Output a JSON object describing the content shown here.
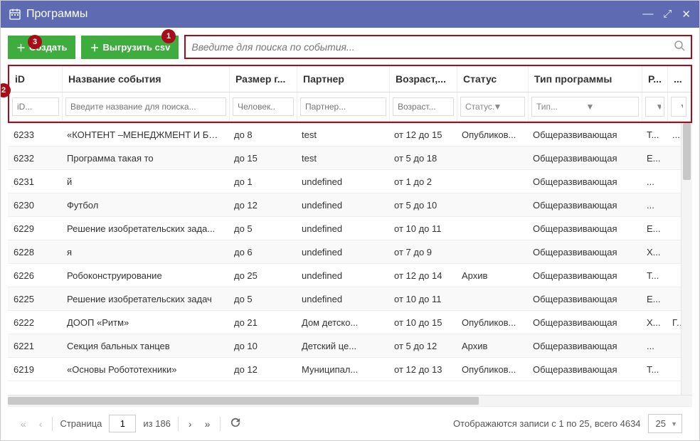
{
  "window": {
    "title": "Программы"
  },
  "toolbar": {
    "create_label": "Создать",
    "export_label": "Выгрузить csv",
    "search_placeholder": "Введите для поиска по события..."
  },
  "markers": {
    "m1": "1",
    "m2": "2",
    "m3": "3"
  },
  "columns": {
    "id": "iD",
    "name": "Название события",
    "size": "Размер г...",
    "partner": "Партнер",
    "age": "Возраст,...",
    "status": "Статус",
    "type": "Тип программы",
    "r": "Р...",
    "dots": "..."
  },
  "filters": {
    "id": "iD...",
    "name": "Введите название для поиска...",
    "size": "Человек..",
    "partner": "Партнер...",
    "age": "Возраст...",
    "status": "Статус...",
    "type": "Тип..."
  },
  "rows": [
    {
      "id": "6233",
      "name": "«КОНТЕНТ –МЕНЕДЖМЕНТ И БЛО...",
      "size": "до 8",
      "partner": "test",
      "age": "от 12 до 15",
      "status": "Опубликов...",
      "type": "Общеразвивающая",
      "r": "Т...",
      "dots": "..."
    },
    {
      "id": "6232",
      "name": "Программа такая то",
      "size": "до 15",
      "partner": "test",
      "age": "от 5 до 18",
      "status": "",
      "type": "Общеразвивающая",
      "r": "Е...",
      "dots": ""
    },
    {
      "id": "6231",
      "name": "й",
      "size": "до 1",
      "partner": "undefined",
      "age": "от 1 до 2",
      "status": "",
      "type": "Общеразвивающая",
      "r": "...",
      "dots": ""
    },
    {
      "id": "6230",
      "name": "Футбол",
      "size": "до 12",
      "partner": "undefined",
      "age": "от 5 до 10",
      "status": "",
      "type": "Общеразвивающая",
      "r": "...",
      "dots": ""
    },
    {
      "id": "6229",
      "name": "Решение изобретательских зада...",
      "size": "до 5",
      "partner": "undefined",
      "age": "от 10 до 11",
      "status": "",
      "type": "Общеразвивающая",
      "r": "Е...",
      "dots": ""
    },
    {
      "id": "6228",
      "name": "я",
      "size": "до 6",
      "partner": "undefined",
      "age": "от 7 до 9",
      "status": "",
      "type": "Общеразвивающая",
      "r": "Х...",
      "dots": ""
    },
    {
      "id": "6226",
      "name": "Робоконструирование",
      "size": "до 25",
      "partner": "undefined",
      "age": "от 12 до 14",
      "status": "Архив",
      "type": "Общеразвивающая",
      "r": "Т...",
      "dots": ""
    },
    {
      "id": "6225",
      "name": "Решение изобретательских задач",
      "size": "до 5",
      "partner": "undefined",
      "age": "от 10 до 11",
      "status": "",
      "type": "Общеразвивающая",
      "r": "Е...",
      "dots": ""
    },
    {
      "id": "6222",
      "name": "ДООП «Ритм»",
      "size": "до 21",
      "partner": "Дом детско...",
      "age": "от 10 до 15",
      "status": "Опубликов...",
      "type": "Общеразвивающая",
      "r": "Х...",
      "dots": "Г..."
    },
    {
      "id": "6221",
      "name": "Секция бальных танцев",
      "size": "до 10",
      "partner": "Детский це...",
      "age": "от 5 до 12",
      "status": "Архив",
      "type": "Общеразвивающая",
      "r": "...",
      "dots": ""
    },
    {
      "id": "6219",
      "name": "«Основы Робототехники»",
      "size": "до 12",
      "partner": "Муниципал...",
      "age": "от 12 до 13",
      "status": "Опубликов...",
      "type": "Общеразвивающая",
      "r": "Т...",
      "dots": ""
    }
  ],
  "pager": {
    "page_label": "Страница",
    "current_page": "1",
    "of_label": "из 186",
    "display_text": "Отображаются записи с 1 по 25, всего 4634",
    "page_size": "25"
  }
}
